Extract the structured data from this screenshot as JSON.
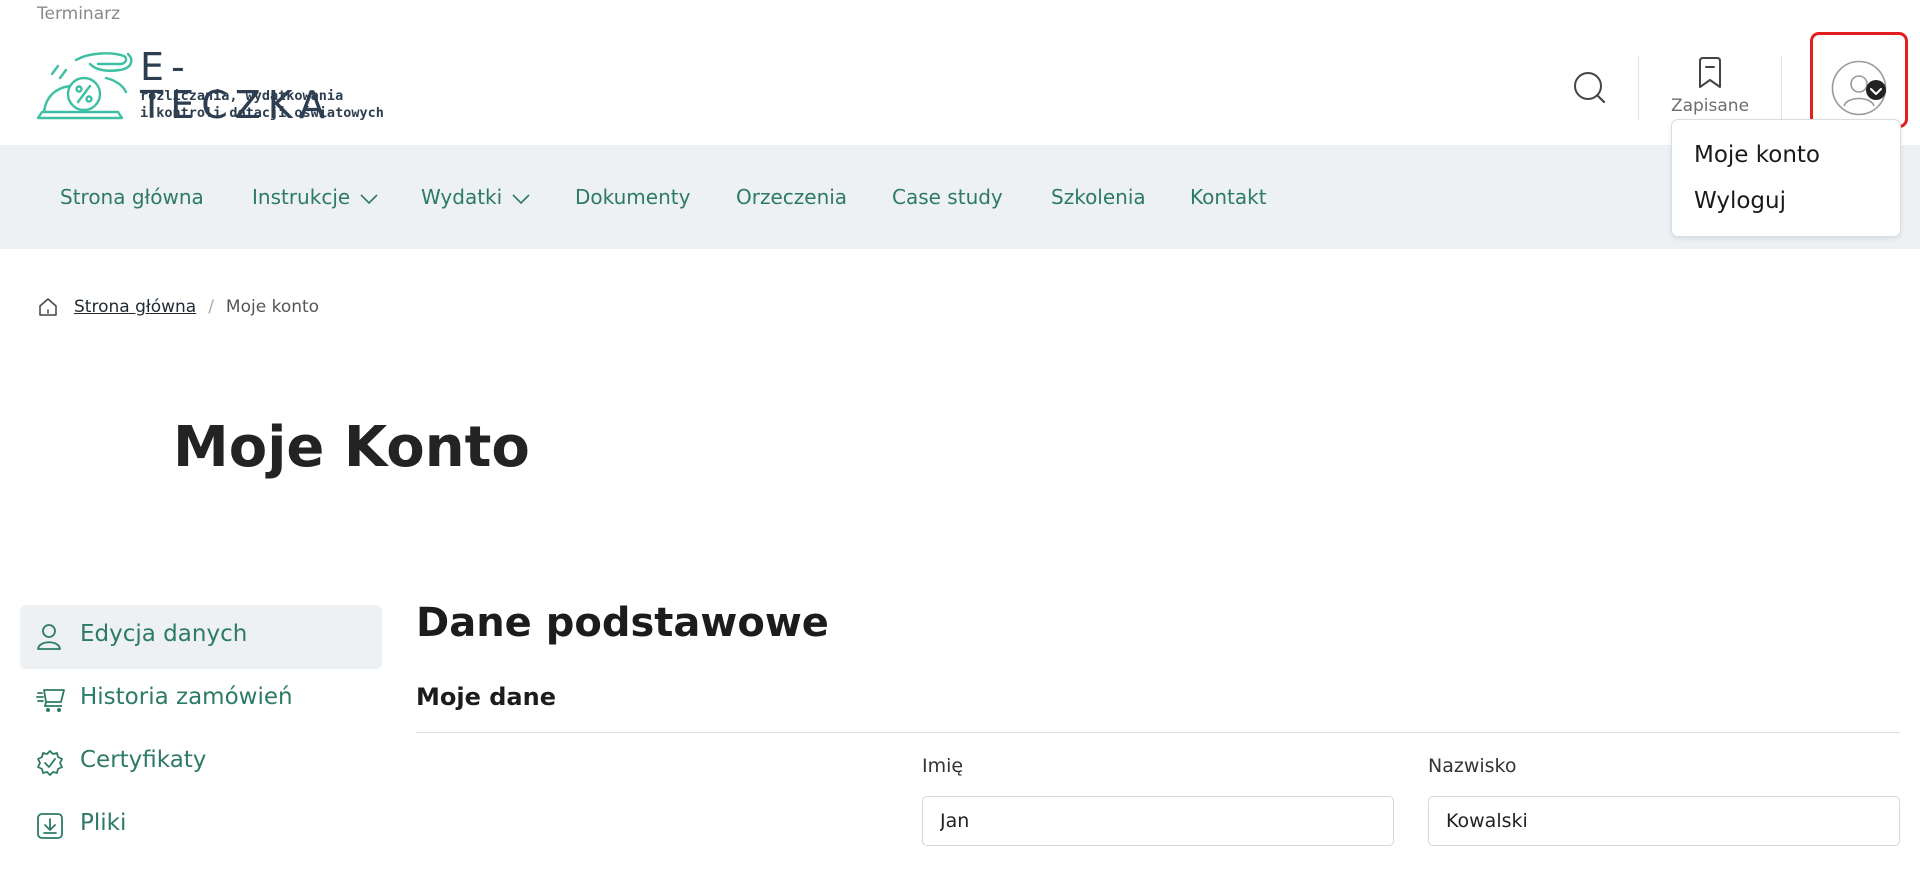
{
  "header": {
    "top_link": "Terminarz",
    "logo": {
      "brand": "E-TECZKA",
      "tagline_1": "rozliczania, wydatkowania",
      "tagline_2": "i kontroli dotacji oświatowych"
    },
    "search_icon": "search-icon",
    "saved_label": "Zapisane",
    "saved_icon": "bookmark-icon",
    "account_icon": "user-avatar-icon",
    "highlight_color": "#e41e1e"
  },
  "nav": {
    "items": [
      {
        "label": "Strona główna"
      },
      {
        "label": "Instrukcje",
        "dropdown": true
      },
      {
        "label": "Wydatki",
        "dropdown": true
      },
      {
        "label": "Dokumenty"
      },
      {
        "label": "Orzeczenia"
      },
      {
        "label": "Case study"
      },
      {
        "label": "Szkolenia"
      },
      {
        "label": "Kontakt"
      }
    ]
  },
  "account_menu": {
    "items": [
      {
        "label": "Moje konto"
      },
      {
        "label": "Wyloguj"
      }
    ]
  },
  "breadcrumb": {
    "home": "Strona główna",
    "current": "Moje konto"
  },
  "page": {
    "title": "Moje Konto"
  },
  "sidebar": {
    "items": [
      {
        "label": "Edycja danych",
        "icon": "user-icon",
        "active": true
      },
      {
        "label": "Historia zamówień",
        "icon": "cart-icon"
      },
      {
        "label": "Certyfikaty",
        "icon": "certificate-icon"
      },
      {
        "label": "Pliki",
        "icon": "download-icon"
      }
    ]
  },
  "form": {
    "section_title": "Dane podstawowe",
    "subsection_title": "Moje dane",
    "first_name_label": "Imię",
    "first_name_value": "Jan",
    "last_name_label": "Nazwisko",
    "last_name_value": "Kowalski"
  },
  "colors": {
    "accent": "#2d7a66",
    "nav_bg": "#edf1f4",
    "logo_teal": "#3dbfa3"
  }
}
